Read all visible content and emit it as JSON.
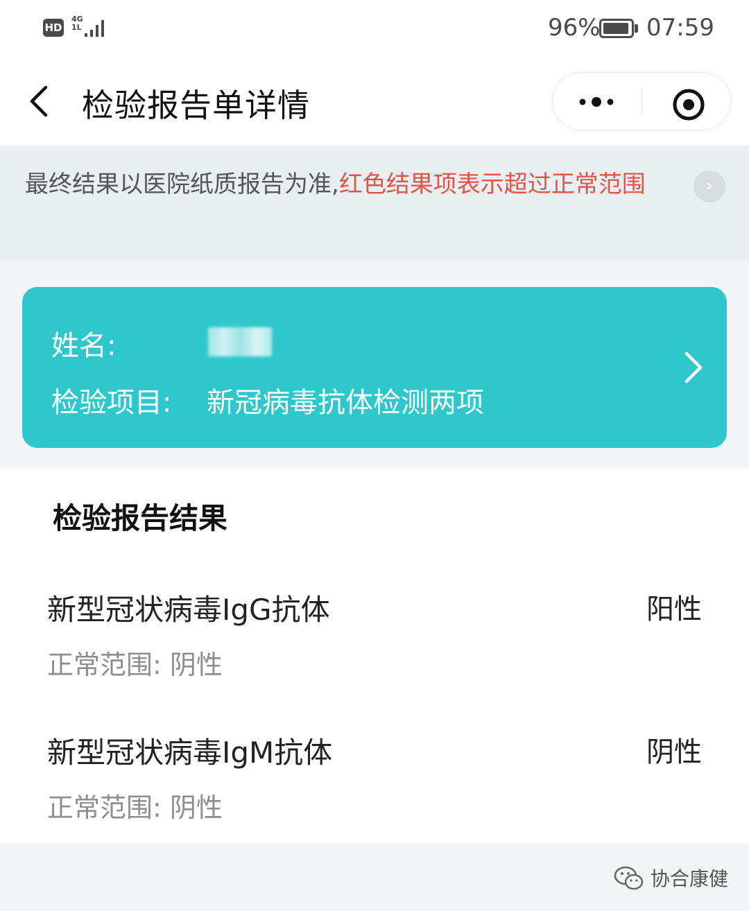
{
  "status_bar": {
    "hd_badge": "HD",
    "network_top": "4G",
    "network_bottom": "1L",
    "battery_percent": "96%",
    "battery_level": 0.96,
    "time": "07:59"
  },
  "nav": {
    "title": "检验报告单详情",
    "icons": [
      "back-icon",
      "more-icon",
      "target-icon"
    ]
  },
  "notice": {
    "text_normal": "最终结果以医院纸质报告为准,",
    "text_warning": "红色结果项表示超过正常范围",
    "close_symbol": "›",
    "warning_color": "#e2534a"
  },
  "patient_card": {
    "name_label": "姓名:",
    "item_label": "检验项目:",
    "item_value": "新冠病毒抗体检测两项",
    "color": "#2ec7cb"
  },
  "results": {
    "title": "检验报告结果",
    "items": [
      {
        "name": "新型冠状病毒IgG抗体",
        "value": "阳性",
        "range": "正常范围:  阴性"
      },
      {
        "name": "新型冠状病毒IgM抗体",
        "value": "阴性",
        "range": "正常范围:  阴性"
      }
    ]
  },
  "footer": {
    "watermark": "协合康健"
  }
}
